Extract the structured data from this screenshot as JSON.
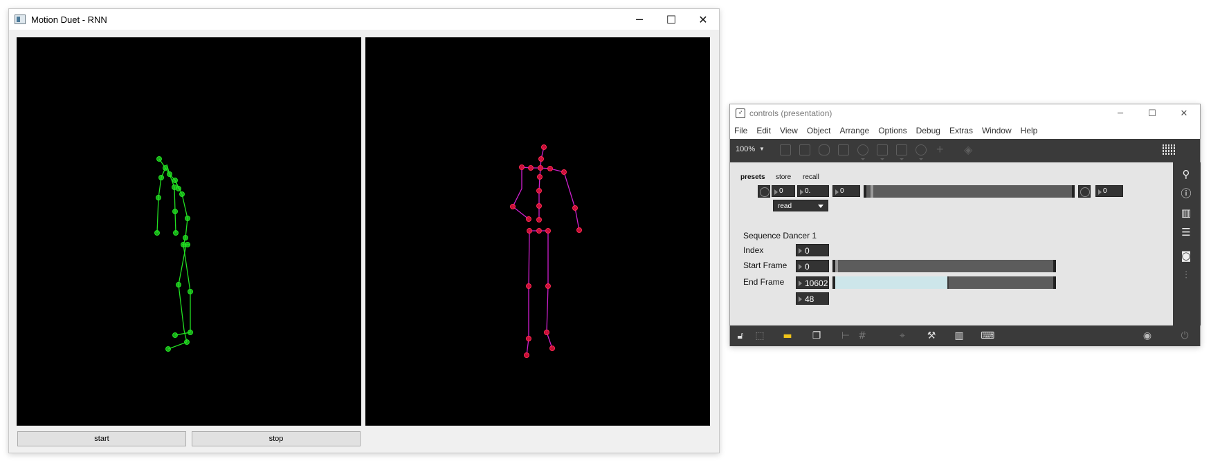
{
  "motion_window": {
    "title": "Motion Duet - RNN",
    "controls": {
      "minimize": "─",
      "maximize": "☐",
      "close": "✕"
    },
    "buttons": {
      "start": "start",
      "stop": "stop"
    },
    "colors": {
      "dancer_left": "#22e022",
      "dancer_right_bones": "#d020d0",
      "dancer_right_joints": "#e0103a",
      "canvas_bg": "#000000"
    }
  },
  "controls_window": {
    "title": "controls (presentation)",
    "controls": {
      "minimize": "─",
      "maximize": "☐",
      "close": "✕"
    },
    "menu": [
      "File",
      "Edit",
      "View",
      "Object",
      "Arrange",
      "Options",
      "Debug",
      "Extras",
      "Window",
      "Help"
    ],
    "toolbar": {
      "zoom": "100%"
    },
    "presets": {
      "title": "presets",
      "store": "store",
      "recall": "recall",
      "box_a": "0",
      "box_b": "0.",
      "box_c": "0",
      "box_d": "0",
      "read_menu": "read",
      "slider_fraction": 0.02
    },
    "sequence": {
      "title": "Sequence Dancer 1",
      "index_label": "Index",
      "index_value": "0",
      "start_label": "Start Frame",
      "start_value": "0",
      "start_slider_fraction": 0.0,
      "end_label": "End Frame",
      "end_value": "10602",
      "end_slider_fraction": 0.52,
      "extra_value": "48"
    },
    "colors": {
      "selection_fill": "#cde6ea",
      "yellow_icon": "#f0c419"
    }
  }
}
